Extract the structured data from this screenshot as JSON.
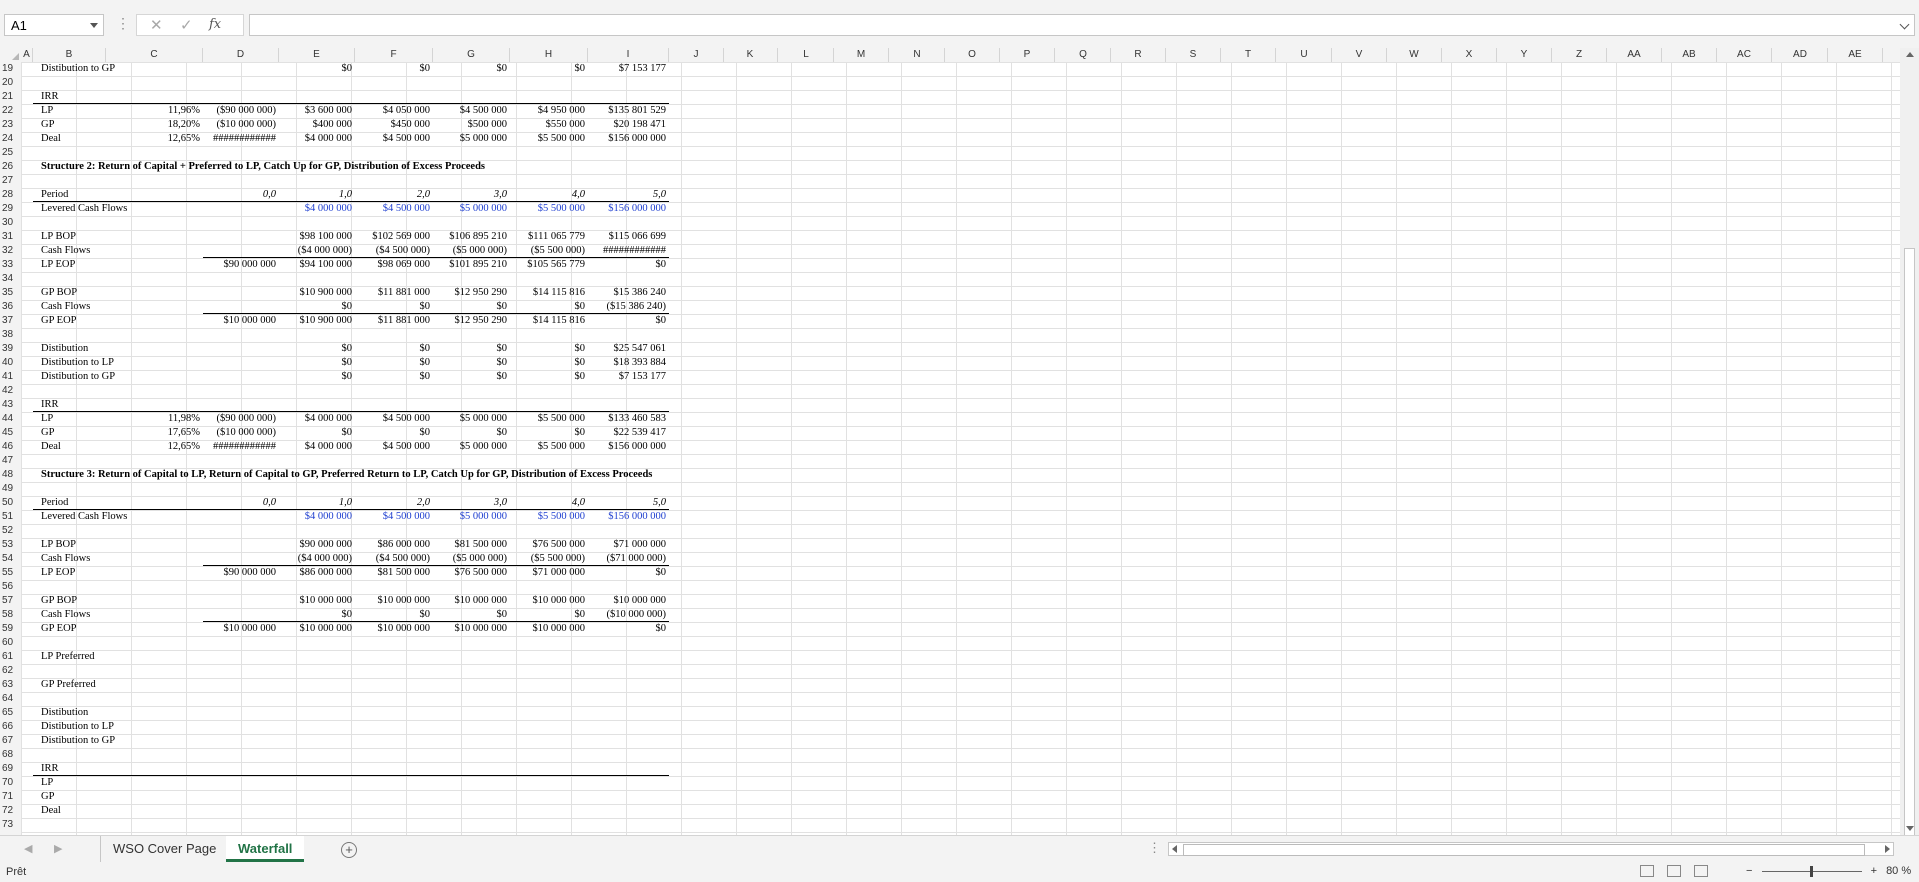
{
  "formula_bar": {
    "name_box": "A1",
    "fx_label": "fx",
    "formula": ""
  },
  "columns": [
    "A",
    "B",
    "C",
    "D",
    "E",
    "F",
    "G",
    "H",
    "I",
    "J",
    "K",
    "L",
    "M",
    "N",
    "O",
    "P",
    "Q",
    "R",
    "S",
    "T",
    "U",
    "V",
    "W",
    "X",
    "Y",
    "Z",
    "AA",
    "AB",
    "AC",
    "AD",
    "AE"
  ],
  "rows": [
    "19",
    "20",
    "21",
    "22",
    "23",
    "24",
    "25",
    "26",
    "27",
    "28",
    "29",
    "30",
    "31",
    "32",
    "33",
    "34",
    "35",
    "36",
    "37",
    "38",
    "39",
    "40",
    "41",
    "42",
    "43",
    "44",
    "45",
    "46",
    "47",
    "48",
    "49",
    "50",
    "51",
    "52",
    "53",
    "54",
    "55",
    "56",
    "57",
    "58",
    "59",
    "60",
    "61",
    "62",
    "63",
    "64",
    "65",
    "66",
    "67",
    "68",
    "69",
    "70",
    "71",
    "72",
    "73"
  ],
  "sheet": {
    "r19": {
      "label": "Distibution to GP",
      "e": "$0",
      "f": "$0",
      "g": "$0",
      "h": "$0",
      "i": "$7 153 177"
    },
    "r21": {
      "label": "IRR"
    },
    "r22": {
      "label": "LP",
      "c": "11,96%",
      "d": "($90 000 000)",
      "e": "$3 600 000",
      "f": "$4 050 000",
      "g": "$4 500 000",
      "h": "$4 950 000",
      "i": "$135 801 529"
    },
    "r23": {
      "label": "GP",
      "c": "18,20%",
      "d": "($10 000 000)",
      "e": "$400 000",
      "f": "$450 000",
      "g": "$500 000",
      "h": "$550 000",
      "i": "$20 198 471"
    },
    "r24": {
      "label": "Deal",
      "c": "12,65%",
      "d": "############",
      "e": "$4 000 000",
      "f": "$4 500 000",
      "g": "$5 000 000",
      "h": "$5 500 000",
      "i": "$156 000 000"
    },
    "r26": {
      "title": "Structure 2: Return of Capital + Preferred to LP, Catch Up for GP, Distribution of Excess Proceeds"
    },
    "r28": {
      "label": "Period",
      "d": "0,0",
      "e": "1,0",
      "f": "2,0",
      "g": "3,0",
      "h": "4,0",
      "i": "5,0"
    },
    "r29": {
      "label": "Levered Cash Flows",
      "e": "$4 000 000",
      "f": "$4 500 000",
      "g": "$5 000 000",
      "h": "$5 500 000",
      "i": "$156 000 000"
    },
    "r31": {
      "label": "LP BOP",
      "e": "$98 100 000",
      "f": "$102 569 000",
      "g": "$106 895 210",
      "h": "$111 065 779",
      "i": "$115 066 699"
    },
    "r32": {
      "label": "Cash Flows",
      "e": "($4 000 000)",
      "f": "($4 500 000)",
      "g": "($5 000 000)",
      "h": "($5 500 000)",
      "i": "############"
    },
    "r33": {
      "label": "LP EOP",
      "d": "$90 000 000",
      "e": "$94 100 000",
      "f": "$98 069 000",
      "g": "$101 895 210",
      "h": "$105 565 779",
      "i": "$0"
    },
    "r35": {
      "label": "GP BOP",
      "e": "$10 900 000",
      "f": "$11 881 000",
      "g": "$12 950 290",
      "h": "$14 115 816",
      "i": "$15 386 240"
    },
    "r36": {
      "label": "Cash Flows",
      "e": "$0",
      "f": "$0",
      "g": "$0",
      "h": "$0",
      "i": "($15 386 240)"
    },
    "r37": {
      "label": "GP EOP",
      "d": "$10 000 000",
      "e": "$10 900 000",
      "f": "$11 881 000",
      "g": "$12 950 290",
      "h": "$14 115 816",
      "i": "$0"
    },
    "r39": {
      "label": "Distibution",
      "e": "$0",
      "f": "$0",
      "g": "$0",
      "h": "$0",
      "i": "$25 547 061"
    },
    "r40": {
      "label": "Distibution to LP",
      "e": "$0",
      "f": "$0",
      "g": "$0",
      "h": "$0",
      "i": "$18 393 884"
    },
    "r41": {
      "label": "Distibution to GP",
      "e": "$0",
      "f": "$0",
      "g": "$0",
      "h": "$0",
      "i": "$7 153 177"
    },
    "r43": {
      "label": "IRR"
    },
    "r44": {
      "label": "LP",
      "c": "11,98%",
      "d": "($90 000 000)",
      "e": "$4 000 000",
      "f": "$4 500 000",
      "g": "$5 000 000",
      "h": "$5 500 000",
      "i": "$133 460 583"
    },
    "r45": {
      "label": "GP",
      "c": "17,65%",
      "d": "($10 000 000)",
      "e": "$0",
      "f": "$0",
      "g": "$0",
      "h": "$0",
      "i": "$22 539 417"
    },
    "r46": {
      "label": "Deal",
      "c": "12,65%",
      "d": "############",
      "e": "$4 000 000",
      "f": "$4 500 000",
      "g": "$5 000 000",
      "h": "$5 500 000",
      "i": "$156 000 000"
    },
    "r48": {
      "title": "Structure 3: Return of Capital to LP, Return of Capital to GP, Preferred Return to LP, Catch Up for GP, Distribution of Excess Proceeds"
    },
    "r50": {
      "label": "Period",
      "d": "0,0",
      "e": "1,0",
      "f": "2,0",
      "g": "3,0",
      "h": "4,0",
      "i": "5,0"
    },
    "r51": {
      "label": "Levered Cash Flows",
      "e": "$4 000 000",
      "f": "$4 500 000",
      "g": "$5 000 000",
      "h": "$5 500 000",
      "i": "$156 000 000"
    },
    "r53": {
      "label": "LP BOP",
      "e": "$90 000 000",
      "f": "$86 000 000",
      "g": "$81 500 000",
      "h": "$76 500 000",
      "i": "$71 000 000"
    },
    "r54": {
      "label": "Cash Flows",
      "e": "($4 000 000)",
      "f": "($4 500 000)",
      "g": "($5 000 000)",
      "h": "($5 500 000)",
      "i": "($71 000 000)"
    },
    "r55": {
      "label": "LP EOP",
      "d": "$90 000 000",
      "e": "$86 000 000",
      "f": "$81 500 000",
      "g": "$76 500 000",
      "h": "$71 000 000",
      "i": "$0"
    },
    "r57": {
      "label": "GP BOP",
      "e": "$10 000 000",
      "f": "$10 000 000",
      "g": "$10 000 000",
      "h": "$10 000 000",
      "i": "$10 000 000"
    },
    "r58": {
      "label": "Cash Flows",
      "e": "$0",
      "f": "$0",
      "g": "$0",
      "h": "$0",
      "i": "($10 000 000)"
    },
    "r59": {
      "label": "GP EOP",
      "d": "$10 000 000",
      "e": "$10 000 000",
      "f": "$10 000 000",
      "g": "$10 000 000",
      "h": "$10 000 000",
      "i": "$0"
    },
    "r61": {
      "label": "LP Preferred"
    },
    "r63": {
      "label": "GP Preferred"
    },
    "r65": {
      "label": "Distibution"
    },
    "r66": {
      "label": "Distibution to LP"
    },
    "r67": {
      "label": "Distibution to GP"
    },
    "r69": {
      "label": "IRR"
    },
    "r70": {
      "label": "LP"
    },
    "r71": {
      "label": "GP"
    },
    "r72": {
      "label": "Deal"
    }
  },
  "tabs": {
    "cover": "WSO Cover Page",
    "waterfall": "Waterfall"
  },
  "status": {
    "ready": "Prêt",
    "zoom": "80 %"
  }
}
